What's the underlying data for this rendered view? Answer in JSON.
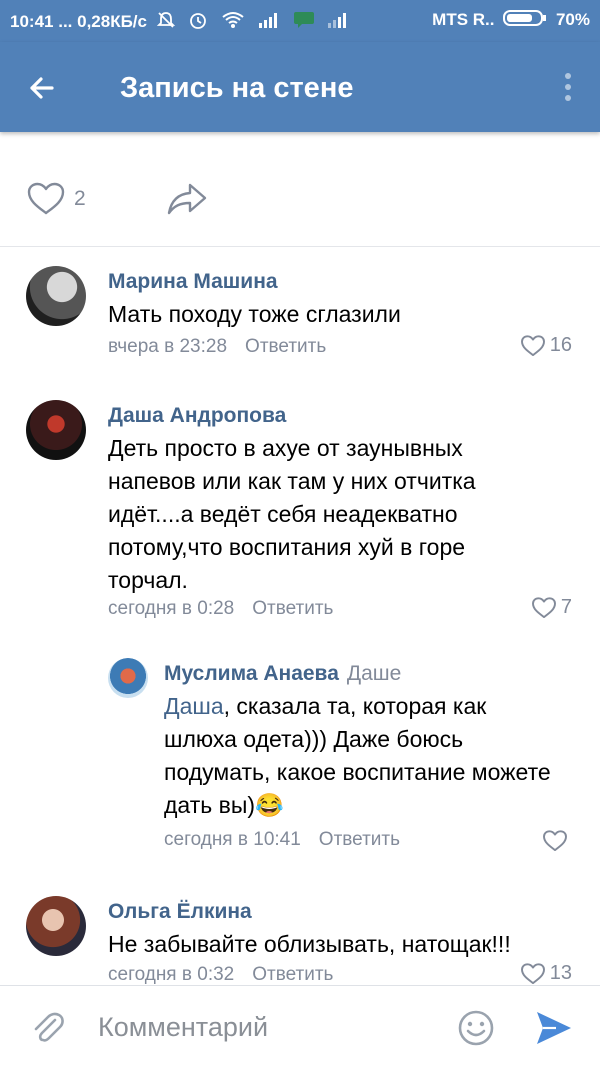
{
  "status_bar": {
    "time": "10:41",
    "dots": "...",
    "speed": "0,28КБ/с",
    "carrier": "MTS R..",
    "battery": "70%"
  },
  "header": {
    "title": "Запись на стене",
    "back_icon": "arrow-left-icon",
    "menu_icon": "more-vertical-icon"
  },
  "post_actions": {
    "likes": "2",
    "like_icon": "heart-outline-icon",
    "share_icon": "share-arrow-icon"
  },
  "comments": [
    {
      "author": "Марина Машина",
      "text": "Мать походу тоже сглазили",
      "time": "вчера в 23:28",
      "reply_label": "Ответить",
      "likes": "16"
    },
    {
      "author": "Даша Андропова",
      "text": "Деть просто в ахуе от заунывных напевов или как там у них отчитка идёт....а ведёт себя неадекватно потому,что воспитания хуй в горе торчал.",
      "time": "сегодня в 0:28",
      "reply_label": "Ответить",
      "likes": "7"
    },
    {
      "author": "Муслима Анаева",
      "reply_to": "Даше",
      "mention": "Даша",
      "text": ", сказала та, которая как шлюха одета))) Даже боюсь подумать, какое воспитание можете дать вы)",
      "emoji": "😂",
      "time": "сегодня в 10:41",
      "reply_label": "Ответить",
      "likes": ""
    },
    {
      "author": "Ольга Ёлкина",
      "text": "Не забывайте облизывать, натощак!!!",
      "time": "сегодня в 0:32",
      "reply_label": "Ответить",
      "likes": "13"
    }
  ],
  "composer": {
    "placeholder": "Комментарий",
    "attach_icon": "paperclip-icon",
    "emoji_icon": "smiley-icon",
    "send_icon": "send-icon"
  },
  "colors": {
    "header_bg": "#5181b8",
    "link": "#42648b",
    "meta": "#828a99",
    "send": "#4a89d8"
  }
}
